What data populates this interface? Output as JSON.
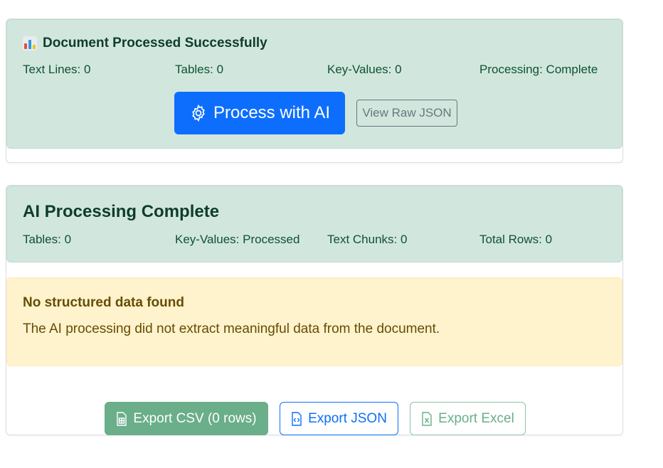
{
  "document_card": {
    "title": "Document Processed Successfully",
    "title_icon": "bar-chart-icon",
    "stats": [
      {
        "label": "Text Lines: 0"
      },
      {
        "label": "Tables: 0"
      },
      {
        "label": "Key-Values: 0"
      },
      {
        "label": "Processing: Complete"
      }
    ],
    "process_button": {
      "label": "Process with AI",
      "icon": "gear-icon"
    },
    "raw_json_button": {
      "label": "View Raw JSON"
    }
  },
  "ai_card": {
    "title": "AI Processing Complete",
    "stats": [
      {
        "label": "Tables: 0"
      },
      {
        "label": "Key-Values: Processed"
      },
      {
        "label": "Text Chunks: 0"
      },
      {
        "label": "Total Rows: 0"
      }
    ],
    "warning": {
      "title": "No structured data found",
      "message": "The AI processing did not extract meaningful data from the document."
    },
    "export_buttons": {
      "csv": {
        "label": "Export CSV (0 rows)",
        "icon": "spreadsheet-file-icon"
      },
      "json": {
        "label": "Export JSON",
        "icon": "code-file-icon"
      },
      "excel": {
        "label": "Export Excel",
        "icon": "excel-file-icon"
      }
    }
  },
  "colors": {
    "success_bg": "#d1e7dd",
    "warning_bg": "#fff3cd",
    "primary": "#0d6efd",
    "success_button": "#6aae8a",
    "secondary": "#6c757d"
  }
}
